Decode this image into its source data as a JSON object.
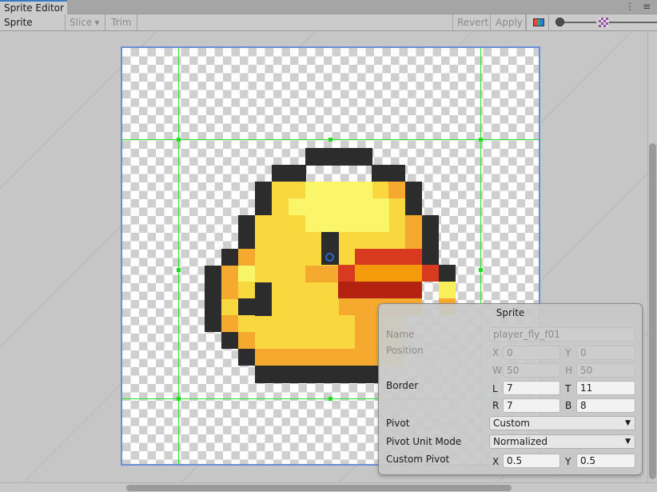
{
  "window": {
    "tab_title": "Sprite Editor"
  },
  "toolbar": {
    "sprite_editor_label": "Sprite Editor",
    "slice_label": "Slice",
    "trim_label": "Trim",
    "revert_label": "Revert",
    "apply_label": "Apply"
  },
  "icons": {
    "tab_menu": "kebab-menu-icon",
    "tab_close": "more-options-icon",
    "color_channel": "rgb-channel-icon",
    "zoom_mipmap": "mipmap-checker-icon"
  },
  "colors": {
    "selection_border": "#6b8ed6",
    "guide_lines": "#27e627",
    "pivot": "#2a67c8"
  },
  "sprite_panel": {
    "title": "Sprite",
    "name_label": "Name",
    "name_value": "player_fly_f01",
    "position_label": "Position",
    "position": {
      "x_label": "X",
      "x": "0",
      "y_label": "Y",
      "y": "0",
      "w_label": "W",
      "w": "50",
      "h_label": "H",
      "h": "50"
    },
    "border_label": "Border",
    "border": {
      "l_label": "L",
      "l": "7",
      "t_label": "T",
      "t": "11",
      "r_label": "R",
      "r": "7",
      "b_label": "B",
      "b": "8"
    },
    "pivot_label": "Pivot",
    "pivot_value": "Custom",
    "pivot_unit_mode_label": "Pivot Unit Mode",
    "pivot_unit_mode_value": "Normalized",
    "custom_pivot_label": "Custom Pivot",
    "custom_pivot": {
      "x_label": "X",
      "x": "0.5",
      "y_label": "Y",
      "y": "0.5"
    }
  }
}
